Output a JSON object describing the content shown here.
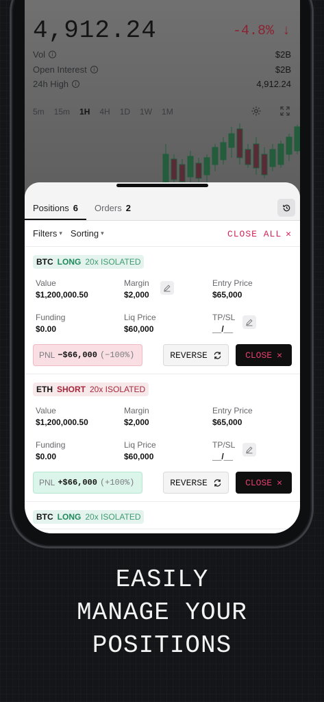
{
  "market": {
    "price": "4,912.24",
    "change": "-4.8% ↓",
    "stats": [
      {
        "label": "Vol",
        "value": "$2B"
      },
      {
        "label": "Open Interest",
        "value": "$2B"
      },
      {
        "label": "24h High",
        "value": "4,912.24"
      }
    ],
    "timeframes": [
      "5m",
      "15m",
      "1H",
      "4H",
      "1D",
      "1W",
      "1M"
    ],
    "active_timeframe": "1H"
  },
  "tabs": [
    {
      "label": "Positions",
      "count": "6"
    },
    {
      "label": "Orders",
      "count": "2"
    }
  ],
  "filterbar": {
    "filters": "Filters",
    "sorting": "Sorting",
    "close_all": "CLOSE ALL"
  },
  "positions": [
    {
      "symbol": "BTC",
      "side": "LONG",
      "leverage": "20x ISOLATED",
      "value_label": "Value",
      "value": "$1,200,000.50",
      "margin_label": "Margin",
      "margin": "$2,000",
      "entry_label": "Entry Price",
      "entry": "$65,000",
      "funding_label": "Funding",
      "funding": "$0.00",
      "liq_label": "Liq Price",
      "liq": "$60,000",
      "tpsl_label": "TP/SL",
      "tpsl": "__/__",
      "pnl_label": "PNL",
      "pnl": "−$66,000",
      "pnl_pct": "(−100%)"
    },
    {
      "symbol": "ETH",
      "side": "SHORT",
      "leverage": "20x ISOLATED",
      "value_label": "Value",
      "value": "$1,200,000.50",
      "margin_label": "Margin",
      "margin": "$2,000",
      "entry_label": "Entry Price",
      "entry": "$65,000",
      "funding_label": "Funding",
      "funding": "$0.00",
      "liq_label": "Liq Price",
      "liq": "$60,000",
      "tpsl_label": "TP/SL",
      "tpsl": "__/__",
      "pnl_label": "PNL",
      "pnl": "+$66,000",
      "pnl_pct": "(+100%)"
    },
    {
      "symbol": "BTC",
      "side": "LONG",
      "leverage": "20x ISOLATED"
    }
  ],
  "buttons": {
    "reverse": "REVERSE",
    "close": "CLOSE"
  },
  "headline": [
    "EASILY",
    "MANAGE YOUR",
    "POSITIONS"
  ]
}
